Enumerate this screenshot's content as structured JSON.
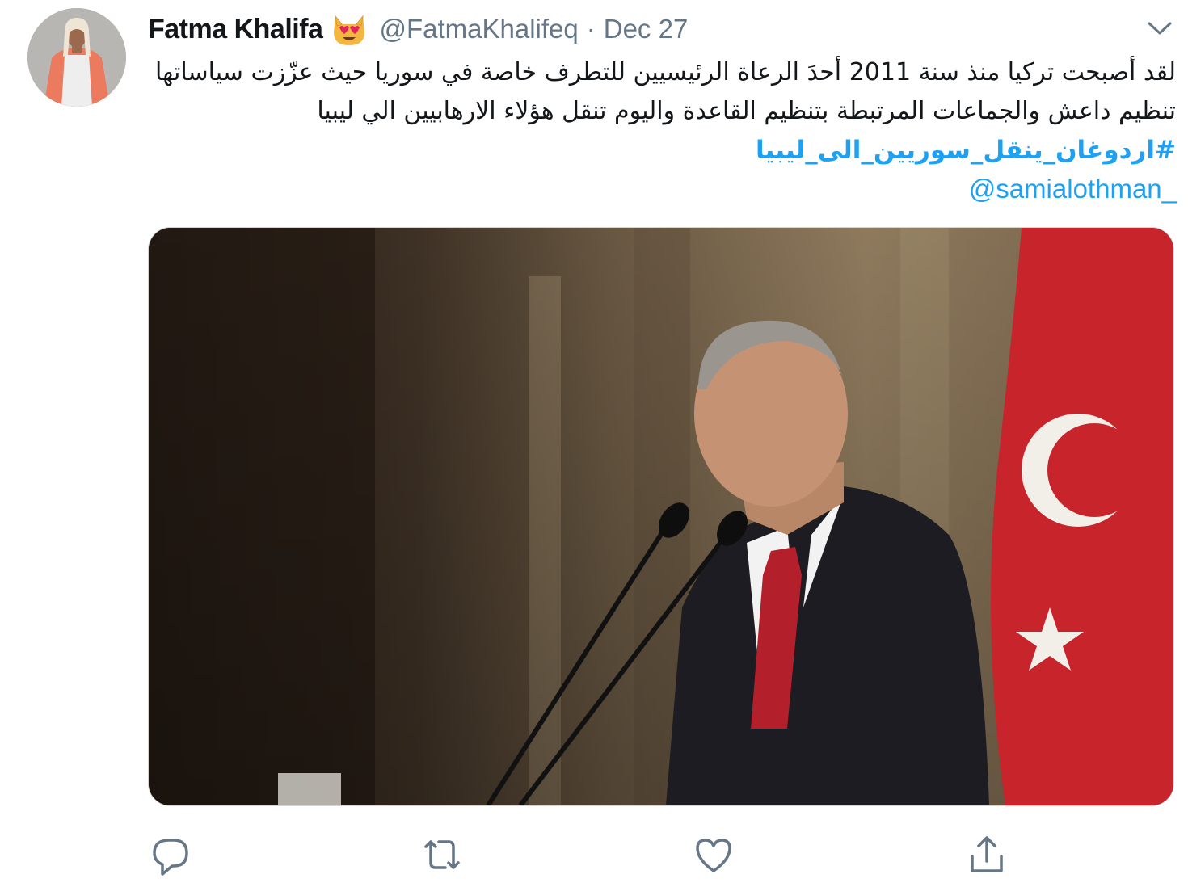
{
  "tweet": {
    "author": {
      "display_name": "Fatma Khalifa",
      "emoji_icon": "heart-eyes-cat-emoji",
      "handle": "@FatmaKhalifeq",
      "separator": "·",
      "date": "Dec 27"
    },
    "text_lines": [
      "لقد أصبحت تركيا منذ سنة 2011 أحدَ الرعاة الرئيسيين للتطرف خاصة في سوريا حيث عزّزت سياساتها",
      "تنظيم داعش والجماعات المرتبطة بتنظيم القاعدة واليوم تنقل هؤلاء الارهابيين الي ليبيا"
    ],
    "hashtag": "#اردوغان_ينقل_سوريين_الى_ليبيا",
    "mention": "@samialothman_",
    "media": {
      "kind": "photo",
      "subject_icon": "speaker-at-podium-photo"
    },
    "actions": {
      "reply": "reply-icon",
      "retweet": "retweet-icon",
      "like": "like-icon",
      "share": "share-icon"
    },
    "menu": "chevron-down-icon",
    "colors": {
      "link": "#1da1f2",
      "text": "#14171a",
      "secondary": "#657786",
      "icon": "#657786"
    }
  }
}
